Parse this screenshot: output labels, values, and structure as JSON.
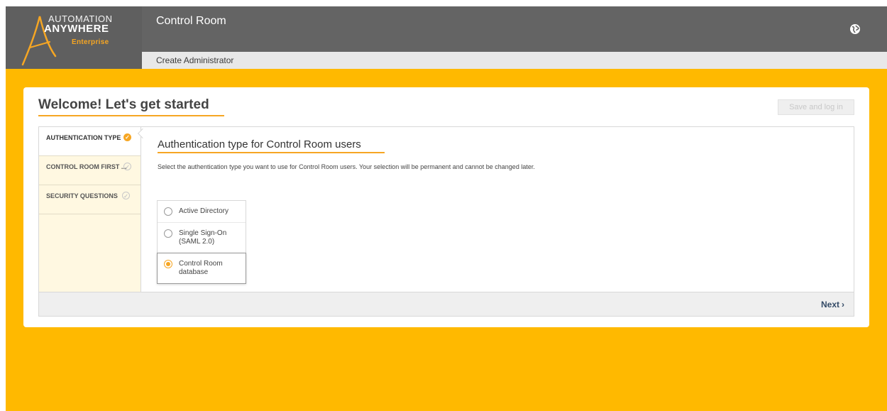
{
  "brand": {
    "line1": "AUTOMATION",
    "line2": "ANYWHERE",
    "line3": "Enterprise"
  },
  "header": {
    "title": "Control Room",
    "breadcrumb": "Create Administrator",
    "globe_icon": "globe-icon"
  },
  "page": {
    "heading": "Welcome! Let's get started",
    "save_label": "Save and log in"
  },
  "steps": [
    {
      "label": "AUTHENTICATION TYPE",
      "status": "active"
    },
    {
      "label": "CONTROL ROOM FIRST ...",
      "status": "pending"
    },
    {
      "label": "SECURITY QUESTIONS",
      "status": "pending"
    }
  ],
  "content": {
    "title": "Authentication type for Control Room users",
    "description": "Select the authentication type you want to use for Control Room users. Your selection will be permanent and cannot be changed later."
  },
  "options": [
    {
      "label": "Active Directory",
      "selected": false
    },
    {
      "label": "Single Sign-On (SAML 2.0)",
      "selected": false
    },
    {
      "label": "Control Room database",
      "selected": true
    }
  ],
  "footer": {
    "next_label": "Next",
    "next_icon": "chevron-right-icon"
  },
  "colors": {
    "background": "#ffb900",
    "header": "#646464",
    "accent": "#f6a623",
    "link": "#334a66"
  }
}
